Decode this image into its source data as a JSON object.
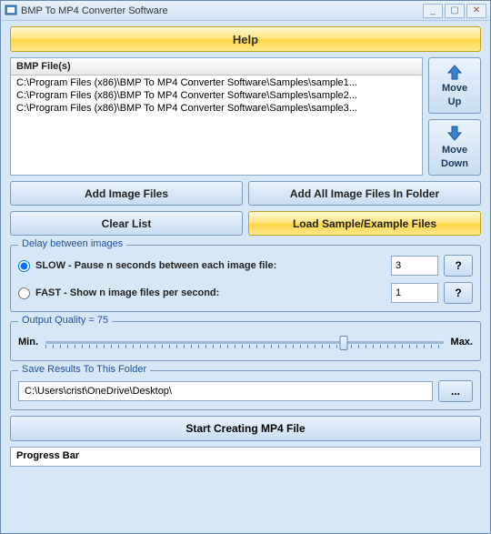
{
  "titlebar": {
    "title": "BMP To MP4 Converter Software"
  },
  "help_button": "Help",
  "file_list": {
    "header": "BMP File(s)",
    "items": [
      "C:\\Program Files (x86)\\BMP To MP4 Converter Software\\Samples\\sample1...",
      "C:\\Program Files (x86)\\BMP To MP4 Converter Software\\Samples\\sample2...",
      "C:\\Program Files (x86)\\BMP To MP4 Converter Software\\Samples\\sample3..."
    ]
  },
  "move": {
    "up1": "Move",
    "up2": "Up",
    "down1": "Move",
    "down2": "Down"
  },
  "buttons": {
    "add_files": "Add Image Files",
    "add_folder": "Add All Image Files In Folder",
    "clear_list": "Clear List",
    "load_samples": "Load Sample/Example Files"
  },
  "delay": {
    "title": "Delay between images",
    "slow_label": "SLOW - Pause n seconds between each image file:",
    "fast_label": "FAST - Show n image files per second:",
    "slow_value": "3",
    "fast_value": "1",
    "q": "?"
  },
  "quality": {
    "title": "Output Quality = 75",
    "min": "Min.",
    "max": "Max.",
    "value": 75
  },
  "save": {
    "title": "Save Results To This Folder",
    "path": "C:\\Users\\crist\\OneDrive\\Desktop\\",
    "browse": "..."
  },
  "start": "Start Creating MP4 File",
  "progress": "Progress Bar"
}
